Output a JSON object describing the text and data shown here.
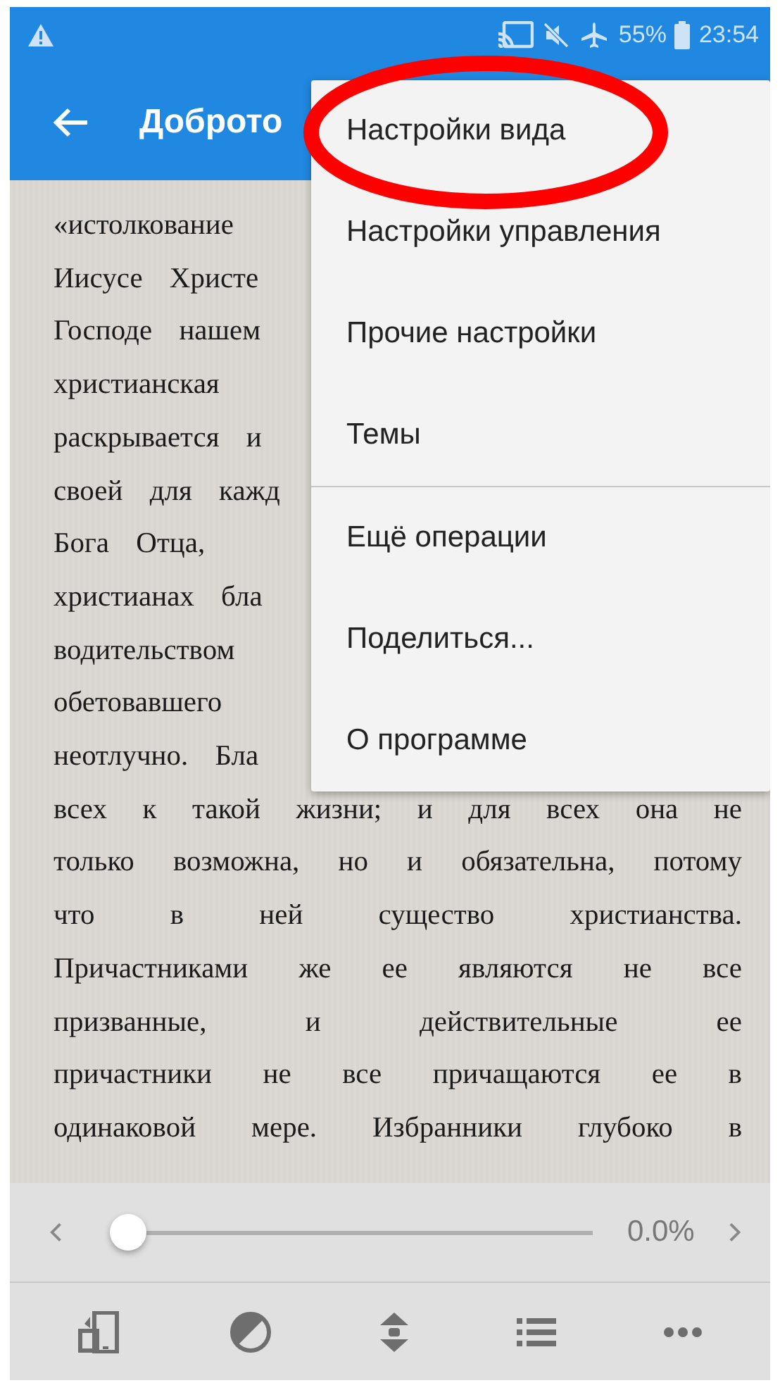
{
  "status_bar": {
    "battery": "55%",
    "time": "23:54"
  },
  "app_bar": {
    "title": "Доброто"
  },
  "text_lines": [
    {
      "text": "«истолкование",
      "partial": true
    },
    {
      "text": "Иисусе Христе",
      "partial": true
    },
    {
      "text": "Господе нашем",
      "partial": true
    },
    {
      "text": "христианская",
      "partial": true
    },
    {
      "text": "раскрывается и",
      "partial": true
    },
    {
      "text": "своей для кажд",
      "partial": true
    },
    {
      "text": "Бога Отца,",
      "partial": true
    },
    {
      "text": "христианах бла",
      "partial": true
    },
    {
      "text": "водительством",
      "partial": true
    },
    {
      "text": "обетовавшего",
      "partial": true
    },
    {
      "text": "неотлучно. Бла",
      "partial": true
    },
    {
      "text": "всех к такой жизни; и для всех она не",
      "partial": false
    },
    {
      "text": "только возможна, но и обязательна, потому",
      "partial": false
    },
    {
      "text": "что в ней существо христианства.",
      "partial": false
    },
    {
      "text": "Причастниками же ее являются не все",
      "partial": false
    },
    {
      "text": "призванные, и действительные ее",
      "partial": false
    },
    {
      "text": "причастники не все причащаются ее в",
      "partial": false
    },
    {
      "text": "одинаковой мере. Избранники глубоко в",
      "partial": false
    }
  ],
  "menu": {
    "items": [
      {
        "label": "Настройки вида",
        "separator_before": false
      },
      {
        "label": "Настройки управления",
        "separator_before": false
      },
      {
        "label": "Прочие настройки",
        "separator_before": false
      },
      {
        "label": "Темы",
        "separator_before": false
      },
      {
        "label": "Ещё операции",
        "separator_before": true
      },
      {
        "label": "Поделиться...",
        "separator_before": false
      },
      {
        "label": "О программе",
        "separator_before": false
      }
    ]
  },
  "progress": {
    "level": 0,
    "reading": "0.0%"
  }
}
